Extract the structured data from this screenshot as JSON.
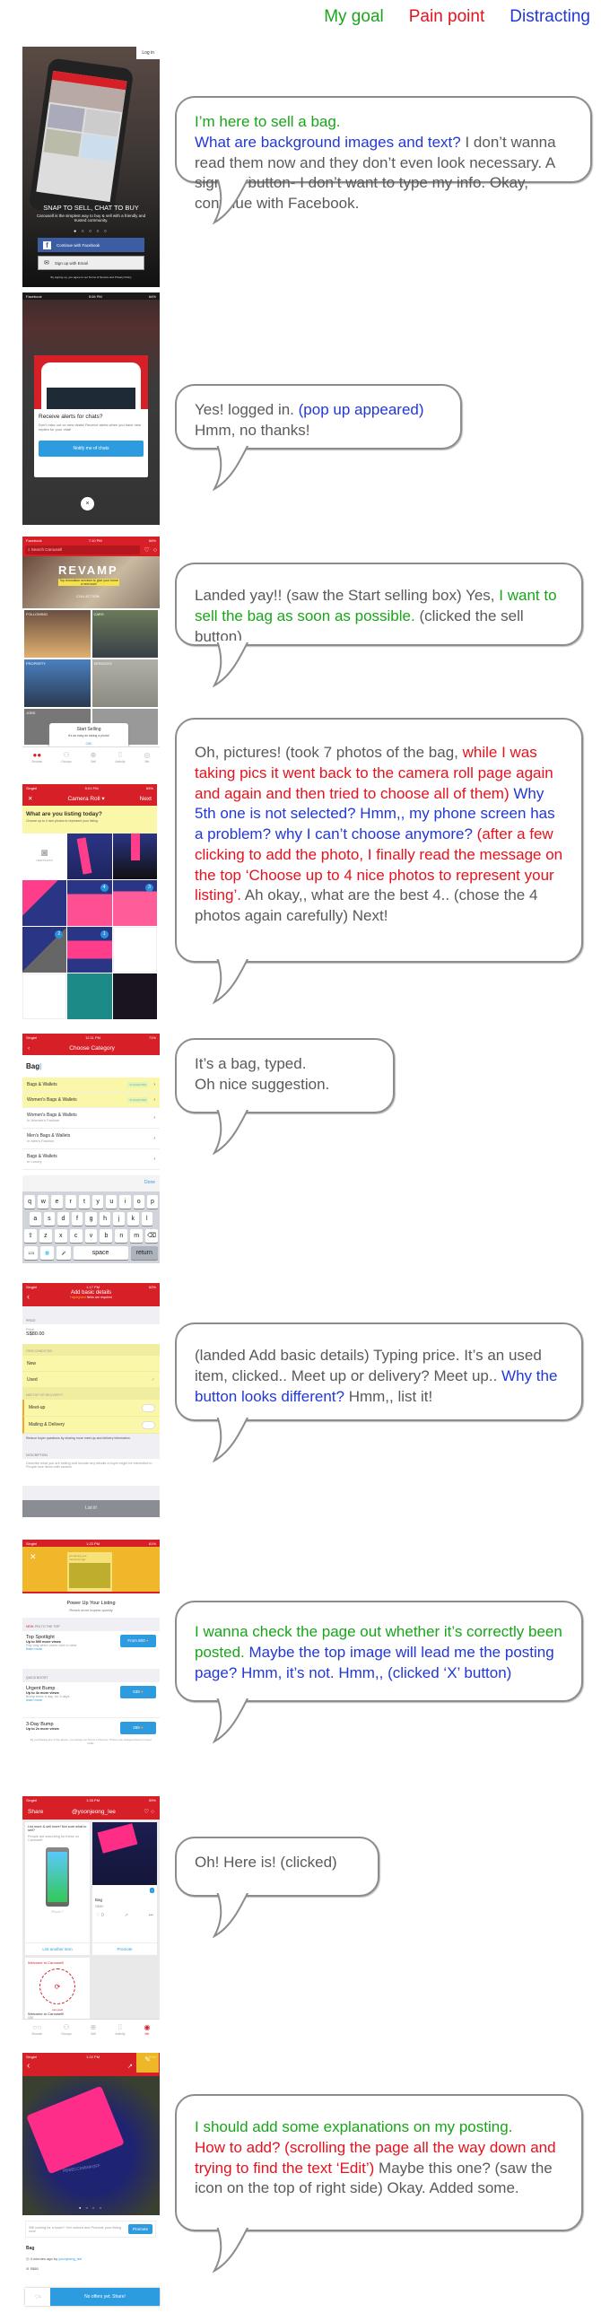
{
  "legend": {
    "goal": "My goal",
    "pain": "Pain point",
    "distracting": "Distracting"
  },
  "colors": {
    "goal": "#19a519",
    "pain": "#e5121d",
    "distracting": "#2138d6",
    "plain": "#5a5a5a",
    "carousell_red": "#d71f27",
    "highlight": "#fbf7a8",
    "blue_button": "#2d9be0"
  },
  "steps": [
    {
      "screen": {
        "login_label": "Log in",
        "headline": "SNAP TO SELL, CHAT TO BUY",
        "subtext": "Carousell is the simplest way to buy & sell with a friendly and trusted community.",
        "facebook_button": "Continue with Facebook",
        "email_button": "Sign up with Email",
        "terms": "By signing up, you agree to our Terms of Service and Privacy Policy"
      },
      "comment": [
        {
          "type": "goal",
          "text": "I’m here to sell a bag."
        },
        {
          "type": "break"
        },
        {
          "type": "distracting",
          "text": "What are background images and text?"
        },
        {
          "type": "plain",
          "text": " I don’t wanna read them now and they don’t even look necessary. A sign up button- I don’t want to type my info. Okay, continue with Facebook."
        }
      ]
    },
    {
      "screen": {
        "status_left": "Facebook",
        "status_time": "5:06 PM",
        "status_right": "64%",
        "popup_title": "Receive alerts for chats?",
        "popup_text": "Don't miss out on new deals! Receive alerts when you have new replies for your chat!",
        "popup_button": "Notify me of chats",
        "close_icon": "×"
      },
      "comment": [
        {
          "type": "plain",
          "text": "Yes! logged in. "
        },
        {
          "type": "distracting",
          "text": "(pop up appeared)"
        },
        {
          "type": "break"
        },
        {
          "type": "plain",
          "text": "Hmm, no thanks!"
        }
      ]
    },
    {
      "screen": {
        "status_left": "Facebook",
        "status_time": "7:10 PM",
        "status_right": "66%",
        "search_placeholder": "Search Carousell",
        "banner_title": "REVAMP",
        "banner_sub": "Top renovation services to give your home a new look!",
        "banner_tag": "COLLECTION",
        "tiles": [
          "FOLLOWING",
          "CARS",
          "PROPERTY",
          "SERVICES",
          "JOBS",
          ""
        ],
        "popup_title": "Start Selling",
        "popup_text": "It's as easy as taking a photo!",
        "popup_ok": "OK!",
        "tabs": [
          "Browse",
          "Groups",
          "Sell",
          "Activity",
          "Me"
        ]
      },
      "comment": [
        {
          "type": "plain",
          "text": "Landed yay!! (saw the Start selling box) Yes, "
        },
        {
          "type": "goal",
          "text": "I want to sell the bag as soon as possible."
        },
        {
          "type": "plain",
          "text": " (clicked the sell button)"
        }
      ]
    },
    {
      "screen": {
        "status_left": "Singtel",
        "status_time": "5:01 PM",
        "status_right": "65%",
        "close": "✕",
        "title": "Camera Roll ▾",
        "next": "Next",
        "prompt_title": "What are you listing today?",
        "prompt_sub": "Choose up to 4 nice photos to represent your listing",
        "new_photo": "NEW PHOTO",
        "badges": [
          "",
          "",
          "",
          "",
          "4",
          "3",
          "2",
          "1",
          "",
          "",
          "",
          ""
        ]
      },
      "comment": [
        {
          "type": "plain",
          "text": "Oh, pictures! (took 7 photos of the bag, "
        },
        {
          "type": "pain",
          "text": "while I was taking pics it went back to the camera roll page again and again and then tried to choose all of them)"
        },
        {
          "type": "distracting",
          "text": " Why 5th one is not selected? Hmm,, my phone screen has a problem? why I can’t choose anymore?"
        },
        {
          "type": "pain",
          "text": " (after a few clicking to add the photo, I finally read the message on the top ‘Choose up to 4 nice photos to represent your listing’."
        },
        {
          "type": "plain",
          "text": " Ah okay,, what are the best 4.. (chose the 4 photos again carefully) Next!"
        }
      ]
    },
    {
      "screen": {
        "status_left": "Singtel",
        "status_time": "12:11 PM",
        "status_right": "71%",
        "title": "Choose Category",
        "input_value": "Bag",
        "suggested_label": "SUGGESTED",
        "suggested": [
          "Bags & Wallets",
          "Women's Bags & Wallets"
        ],
        "categories": [
          {
            "name": "Women's Bags & Wallets",
            "sub": "In Women's Fashion"
          },
          {
            "name": "Men's Bags & Wallets",
            "sub": "In Men's Fashion"
          },
          {
            "name": "Bags & Wallets",
            "sub": "In Luxury"
          }
        ],
        "done": "Done",
        "keys_row1": [
          "q",
          "w",
          "e",
          "r",
          "t",
          "y",
          "u",
          "i",
          "o",
          "p"
        ],
        "keys_row2": [
          "a",
          "s",
          "d",
          "f",
          "g",
          "h",
          "j",
          "k",
          "l"
        ],
        "keys_row3": [
          "⇧",
          "z",
          "x",
          "c",
          "v",
          "b",
          "n",
          "m",
          "⌫"
        ],
        "keys_row4": [
          "123",
          "🌐",
          "🎤",
          "space",
          "return"
        ]
      },
      "comment": [
        {
          "type": "plain",
          "text": "It’s a bag, typed."
        },
        {
          "type": "break"
        },
        {
          "type": "plain",
          "text": "Oh nice suggestion."
        }
      ]
    },
    {
      "screen": {
        "status_left": "Singtel",
        "status_time": "1:17 PM",
        "status_right": "62%",
        "title": "Add basic details",
        "subtitle_highlight": "Highlighted",
        "subtitle_rest": " fields are required",
        "price_section": "PRICE",
        "price_label": "Price",
        "price_value": "S$80.00",
        "condition_section": "ITEM CONDITION",
        "condition_options": [
          "New",
          "Used"
        ],
        "condition_selected": "Used",
        "meetup_section": "MEETUP OR DELIVERY?",
        "meetup_options": [
          "Meet-up",
          "Mailing & Delivery"
        ],
        "meetup_hint": "Reduce buyer questions by sharing more meet-up and delivery information.",
        "description_section": "DESCRIPTION",
        "description_placeholder": "Describe what you are selling and include any details a buyer might be interested in. People love items with stories!",
        "list_button": "List it!"
      },
      "comment": [
        {
          "type": "plain",
          "text": "(landed Add basic details) Typing price. It’s an used item, clicked.. Meet up or delivery? Meet up.. "
        },
        {
          "type": "distracting",
          "text": "Why the button looks different?"
        },
        {
          "type": "plain",
          "text": " Hmm,, list it!"
        }
      ]
    },
    {
      "screen": {
        "status_left": "Singtel",
        "status_time": "1:22 PM",
        "status_right": "61%",
        "close": "✕",
        "card_user": "yoonjeong_lee",
        "card_time": "moments ago",
        "title": "Power Up Your Listing",
        "subtitle": "Reach more buyers quickly",
        "section1_new": "NEW:",
        "section1": " PIN TO THE TOP",
        "options": [
          {
            "name": "Top Spotlight",
            "views": "Up to 500 more views",
            "desc": "Pay only when users click to view",
            "learn": "learn more",
            "price": "From 800"
          },
          {
            "name": "Urgent Bump",
            "views": "Up to 4x more views",
            "desc": "Bump twice a day, for 3 days",
            "learn": "learn more",
            "price": "538"
          },
          {
            "name": "3-Day Bump",
            "views": "Up to 2x more views",
            "desc": "",
            "learn": "",
            "price": "298"
          }
        ],
        "section2": "QUICK BOOST",
        "footer": "By purchasing any of the above, you accept our Terms of Service. Prices may change based on buyer traffic."
      },
      "comment": [
        {
          "type": "goal",
          "text": "I wanna check the page out whether it’s correctly been posted."
        },
        {
          "type": "distracting",
          "text": " Maybe the top image will lead me the posting page? Hmm, it’s not. Hmm,, (clicked ‘X’ button)"
        }
      ]
    },
    {
      "screen": {
        "status_left": "Singtel",
        "status_time": "1:33 PM",
        "status_right": "59%",
        "share": "Share",
        "username": "@yoonjeong_lee",
        "promo_title": "List more & sell more! Not sure what to sell?",
        "promo_sub": "People are searching for these on Carousell:",
        "promo_item": "iPhone 7",
        "list_another": "List another item",
        "item_name": "Bag",
        "item_price": "S$80",
        "item_likes": "0",
        "promote": "Promote",
        "welcome_title": "Welcome to Carousell!",
        "welcome_brand": "carousell",
        "welcome_item": "Welcome to Carousell!",
        "welcome_price": "S$0",
        "welcome_likes": "0",
        "tabs": [
          "Browse",
          "Groups",
          "Sell",
          "Activity",
          "Me"
        ]
      },
      "comment": [
        {
          "type": "plain",
          "text": "Oh! Here is! (clicked)"
        }
      ]
    },
    {
      "screen": {
        "status_left": "Singtel",
        "status_time": "1:22 PM",
        "status_right": "61%",
        "brand_watermark": "REBECCAMINKOFF",
        "promo_text": "Still looking for a buyer? Get noticed and Promote your listing now!",
        "promote": "Promote",
        "item_name": "Bag",
        "meta_time": "4 minutes ago by ",
        "meta_user": "yoonjeong_lee",
        "price": "S$80",
        "likes": "1",
        "share_button": "No offers yet. Share!"
      },
      "comment": [
        {
          "type": "goal",
          "text": "I should add some explanations on my posting."
        },
        {
          "type": "break"
        },
        {
          "type": "pain",
          "text": "How to add? (scrolling the page all the way down and trying to find the text ‘Edit’)"
        },
        {
          "type": "plain",
          "text": " Maybe this one? (saw the icon on the top of right side) Okay. Added some."
        }
      ]
    }
  ]
}
